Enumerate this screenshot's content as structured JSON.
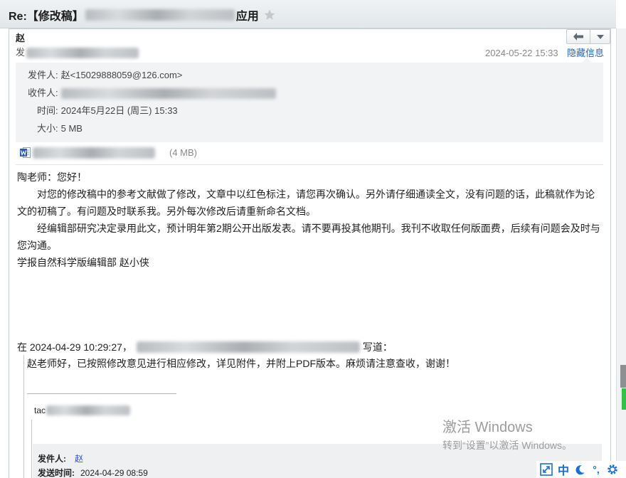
{
  "window": {
    "subject_prefix": "Re:【修改稿】",
    "subject_suffix": "应用"
  },
  "header": {
    "sender_name": "赵",
    "recipient_label": "发",
    "date": "2024-05-22 15:33",
    "toggle_info_label": "隐藏信息"
  },
  "info": {
    "from_label": "发件人:",
    "from_value": "赵<15029888059@126.com>",
    "to_label": "收件人:",
    "time_label": "时间:",
    "time_value": "2024年5月22日 (周三) 15:33",
    "size_label": "大小:",
    "size_value": "5 MB"
  },
  "attachment": {
    "size": "(4 MB)",
    "icon": "word-doc-icon"
  },
  "body": {
    "greeting": "陶老师：您好！",
    "paragraphs": [
      "对您的修改稿中的参考文献做了修改，文章中以红色标注，请您再次确认。另外请仔细通读全文，没有问题的话，此稿就作为论文的初稿了。有问题及时联系我。另外每次修改后请重新命名文档。",
      "经编辑部研究决定录用此文，预计明年第2期公开出版发表。请不要再投其他期刊。我刊不收取任何版面费，后续有问题会及时与您沟通。"
    ],
    "signature": "学报自然科学版编辑部 赵小侠"
  },
  "quote": {
    "intro_prefix": "在 2024-04-29 10:29:27，",
    "intro_suffix": "写道：",
    "text": "赵老师好，已按照修改意见进行相应修改，详见附件，并附上PDF版本。麻烦请注意查收，谢谢！",
    "signature_prefix": "tac",
    "nested": {
      "from_label": "发件人:",
      "from_value": "赵",
      "sent_label": "发送时间:",
      "sent_value": "2024-04-29 08:59"
    }
  },
  "watermark": {
    "title": "激活 Windows",
    "subtitle": "转到“设置”以激活 Windows。"
  },
  "ime_toolbar": {
    "mode_label": "中",
    "punct_label": "°,",
    "icons": [
      "expand-icon",
      "moon-icon",
      "gear-icon"
    ]
  },
  "icons": {
    "subject": "star-icon",
    "reply": "reply-icon",
    "more": "chevron-down-icon"
  },
  "colors": {
    "link": "#2266c8",
    "ime_blue": "#1a6fd6",
    "scroll_green": "#35c04a",
    "info_background": "#f1f3f5"
  }
}
